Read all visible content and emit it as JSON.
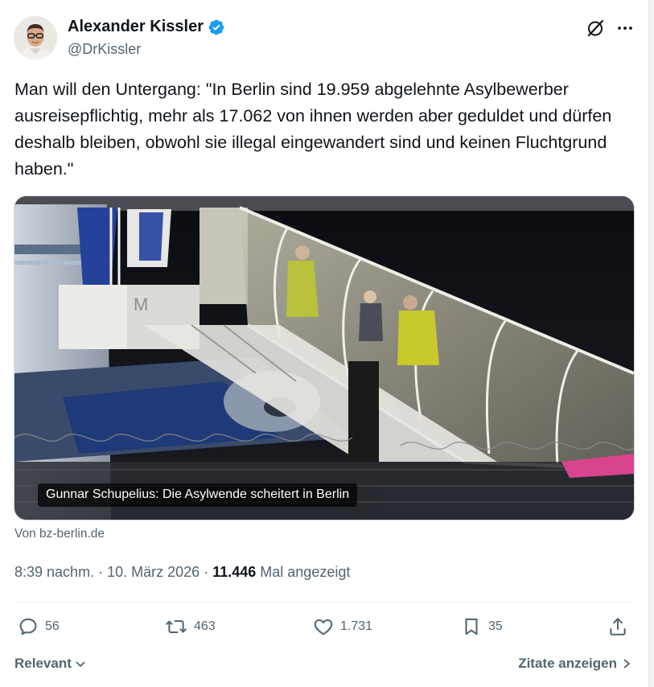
{
  "author": {
    "name": "Alexander Kissler",
    "handle": "@DrKissler",
    "verified_color": "#1d9bf0"
  },
  "header_icons": [
    "grok-icon",
    "more-icon"
  ],
  "tweet": {
    "text": "Man will den Untergang: \"In Berlin sind 19.959 abgelehnte Asylbewerber ausreisepflichtig, mehr als 17.062 von ihnen werden aber geduldet und dürfen deshalb bleiben, obwohl sie illegal eingewandert sind und keinen Fluchtgrund haben.\""
  },
  "card": {
    "caption": "Gunnar Schupelius: Die Asylwende scheitert in Berlin",
    "source": "Von bz-berlin.de",
    "stair_label": "M"
  },
  "meta": {
    "time": "8:39 nachm.",
    "date": "10. März 2026",
    "separator": "·",
    "views_count": "11.446",
    "views_label": "Mal angezeigt"
  },
  "actions": {
    "replies": "56",
    "reposts": "463",
    "likes": "1.731",
    "bookmarks": "35"
  },
  "footer": {
    "sort_label": "Relevant",
    "quotes_label": "Zitate anzeigen"
  },
  "colors": {
    "text": "#0f1419",
    "secondary": "#536471",
    "verified": "#1d9bf0"
  }
}
